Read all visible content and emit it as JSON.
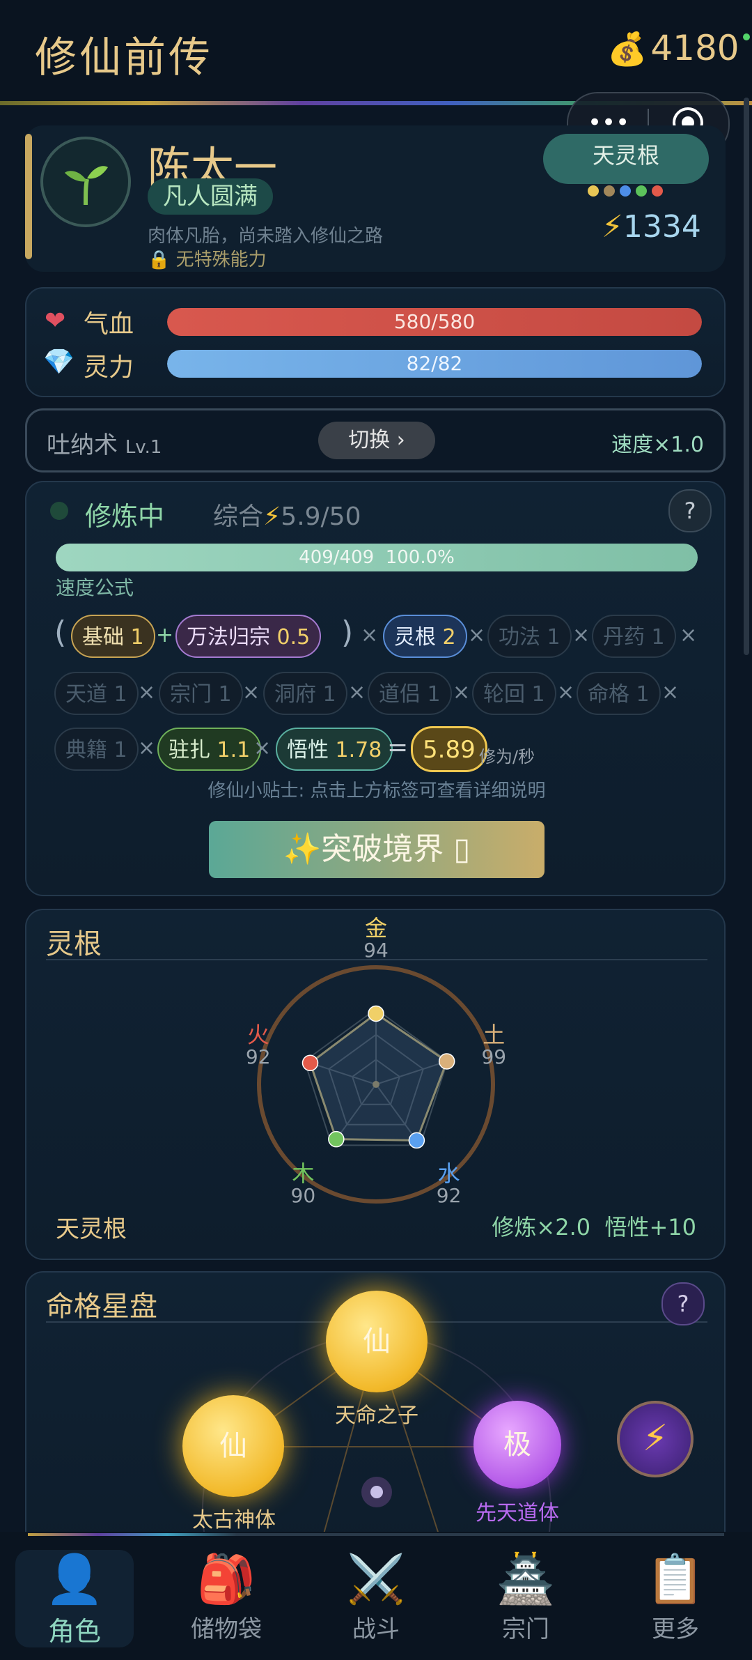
{
  "header": {
    "title": "修仙前传",
    "coins_icon": "money-bag-icon",
    "coins": "4180"
  },
  "capsule": {
    "more": "•••",
    "close": "◎"
  },
  "profile": {
    "avatar_icon": "sprout-icon",
    "name": "陈太一",
    "realm": "凡人圆满",
    "description": "肉体凡胎，尚未踏入修仙之路",
    "ability": "无特殊能力",
    "root_button": "天灵根",
    "root_dots": [
      "#e8c655",
      "#a2875a",
      "#4d8ee8",
      "#5cc25b",
      "#e35a4a"
    ],
    "power": "1334"
  },
  "stats": {
    "hp": {
      "label": "气血",
      "value": "580/580",
      "fill": 1.0,
      "color": "#d8584e"
    },
    "mp": {
      "label": "灵力",
      "value": "82/82",
      "fill": 1.0,
      "color": "#6aa6e6"
    }
  },
  "technique": {
    "name": "吐纳术",
    "level": "Lv.1",
    "switch": "切换 ›",
    "speed": "速度×1.0"
  },
  "cultivation": {
    "status": "修炼中",
    "summary_label": "综合",
    "summary_value": "5.9/50",
    "help": "?",
    "progress_text": "409/409  100.0%",
    "progress": 1.0,
    "formula_label": "速度公式",
    "formula": {
      "basic": {
        "label": "基础",
        "value": "1"
      },
      "wanfa": {
        "label": "万法归宗",
        "value": "0.5"
      },
      "root": {
        "label": "灵根",
        "value": "2"
      },
      "gongfa": {
        "label": "功法",
        "value": "1"
      },
      "danyao": {
        "label": "丹药",
        "value": "1"
      },
      "tiandao": {
        "label": "天道",
        "value": "1"
      },
      "zongmen": {
        "label": "宗门",
        "value": "1"
      },
      "dongfu": {
        "label": "洞府",
        "value": "1"
      },
      "daolv": {
        "label": "道侣",
        "value": "1"
      },
      "lunhui": {
        "label": "轮回",
        "value": "1"
      },
      "mingge": {
        "label": "命格",
        "value": "1"
      },
      "dianji": {
        "label": "典籍",
        "value": "1"
      },
      "zhuzha": {
        "label": "驻扎",
        "value": "1.1"
      },
      "wuxing": {
        "label": "悟性",
        "value": "1.78"
      },
      "result": "5.89",
      "unit": "修为/秒"
    },
    "tip": "修仙小贴士: 点击上方标签可查看详细说明",
    "breakthrough": "✨突破境界 ▯"
  },
  "spirit_root": {
    "title": "灵根",
    "elements": [
      {
        "name": "金",
        "value": "94",
        "color": "#f0d068"
      },
      {
        "name": "土",
        "value": "99",
        "color": "#d9b07a"
      },
      {
        "name": "水",
        "value": "92",
        "color": "#5aa0f0"
      },
      {
        "name": "木",
        "value": "90",
        "color": "#72c45e"
      },
      {
        "name": "火",
        "value": "92",
        "color": "#e35a4a"
      }
    ],
    "type": "天灵根",
    "bonus": "修炼×2.0  悟性+10"
  },
  "fate": {
    "title": "命格星盘",
    "help": "?",
    "orbs": [
      {
        "glyph": "仙",
        "label": "天命之子"
      },
      {
        "glyph": "仙",
        "label": "太古神体"
      },
      {
        "glyph": "极",
        "label": "先天道体"
      }
    ],
    "bolt": "⚡"
  },
  "nav": [
    {
      "icon": "👤",
      "label": "角色",
      "icon_name": "person-icon"
    },
    {
      "icon": "🎒",
      "label": "储物袋",
      "icon_name": "backpack-icon"
    },
    {
      "icon": "⚔️",
      "label": "战斗",
      "icon_name": "crossed-swords-icon"
    },
    {
      "icon": "🏯",
      "label": "宗门",
      "icon_name": "castle-icon"
    },
    {
      "icon": "📋",
      "label": "更多",
      "icon_name": "clipboard-icon"
    }
  ]
}
